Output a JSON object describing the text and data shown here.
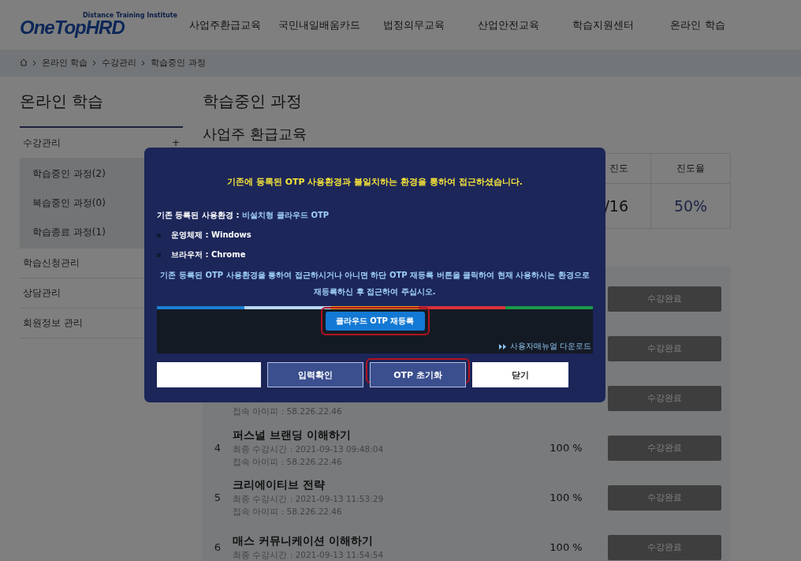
{
  "header": {
    "logo": "OneTopHRD",
    "tagline": "Distance Training Institute",
    "nav": [
      "사업주환급교육",
      "국민내일배움카드",
      "법정의무교육",
      "산업안전교육",
      "학습지원센터",
      "온라인 학습"
    ]
  },
  "breadcrumb": [
    "온라인 학습",
    "수강관리",
    "학습중인 과정"
  ],
  "sidebar": {
    "title": "온라인 학습",
    "items": [
      {
        "label": "수강관리",
        "toggle": "+",
        "children": [
          {
            "label": "학습중인 과정(2)"
          },
          {
            "label": "복습중인 과정(0)"
          },
          {
            "label": "학습종료 과정(1)"
          }
        ]
      },
      {
        "label": "학습신청관리"
      },
      {
        "label": "상담관리"
      },
      {
        "label": "회원정보 관리"
      }
    ]
  },
  "main": {
    "title": "학습중인 과정",
    "subtitle": "사업주 환급교육",
    "progress": {
      "columns": [
        "진도",
        "진도율"
      ],
      "values": [
        "/16",
        "50%"
      ]
    },
    "lessons": [
      {
        "button": "수강완료"
      },
      {
        "button": "수강완료"
      },
      {
        "ip": "접속 아이피 : 58.226.22.46",
        "button": "수강완료"
      },
      {
        "number": "4",
        "title": "퍼스널 브랜딩 이해하기",
        "time": "최종 수강시간 : 2021-09-13 09:48:04",
        "ip": "접속 아이피 : 58.226.22.46",
        "percent": "100 %",
        "button": "수강완료"
      },
      {
        "number": "5",
        "title": "크리에이티브 전략",
        "time": "최종 수강시간 : 2021-09-13 11:53:29",
        "ip": "접속 아이피 : 58.226.22.46",
        "percent": "100 %",
        "button": "수강완료"
      },
      {
        "number": "6",
        "title": "매스 커뮤니케이션 이해하기",
        "time": "최종 수강시간 : 2021-09-13 11:54:54",
        "percent": "100 %",
        "button": "수강완료"
      }
    ]
  },
  "modal": {
    "notice": "기존에 등록된 OTP 사용환경과 불일치하는 환경을 통하여 접근하셨습니다.",
    "env_label": "기존 등록된 사용환경 :",
    "env_value": "비설치형 클라우드 OTP",
    "env_items": [
      "운영체제 : Windows",
      "브라우저 : Chrome"
    ],
    "guide": "기존 등록된 OTP 사용환경을 통하여 접근하시거나 아니면 하단 OTP 재등록 버튼을 클릭하여 현재 사용하시는 환경으로 재등록하신 후 접근하여 주십시오.",
    "reregister": {
      "label": "클라우드 OTP 재등록",
      "highlighted": true
    },
    "manual_link": "사용자매뉴얼 다운로드",
    "buttons": [
      {
        "kind": "field"
      },
      {
        "kind": "button",
        "label": "입력확인",
        "highlighted": false
      },
      {
        "kind": "button",
        "label": "OTP 초기화",
        "highlighted": true
      },
      {
        "kind": "light",
        "label": "닫기",
        "highlighted": false
      }
    ]
  }
}
